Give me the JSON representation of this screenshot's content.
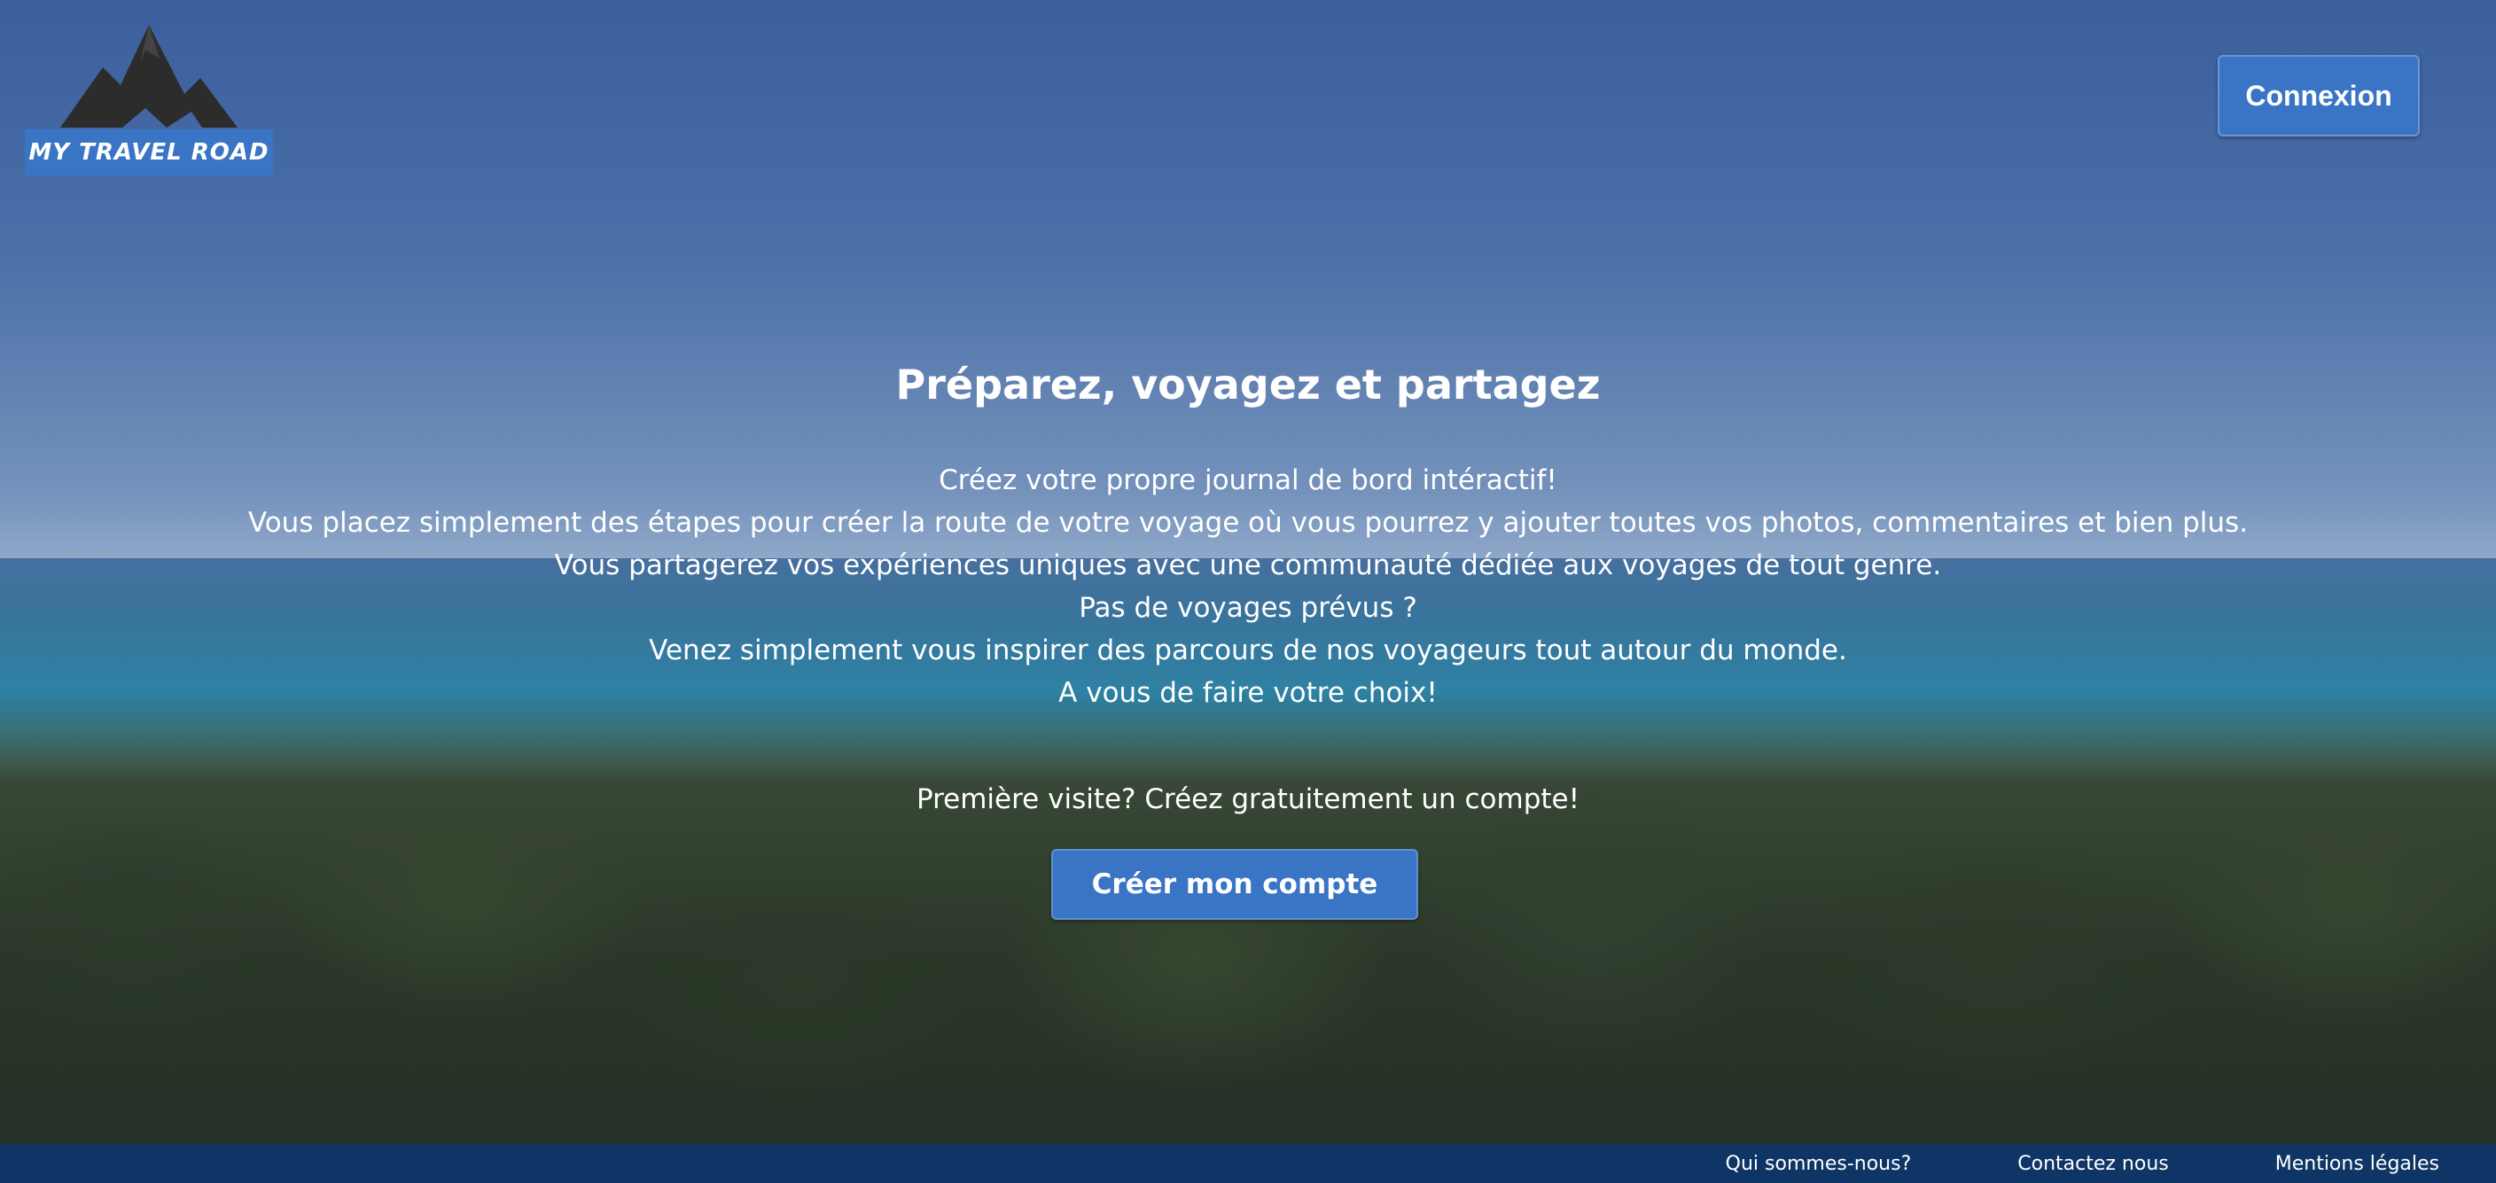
{
  "logo": {
    "text": "MY TRAVEL ROAD",
    "icon": "mountain-icon"
  },
  "header": {
    "login_label": "Connexion"
  },
  "hero": {
    "title": "Préparez, voyagez et partagez",
    "lines": [
      "Créez votre propre journal de bord intéractif!",
      "Vous placez simplement des étapes pour créer la route de votre voyage où vous pourrez y ajouter toutes vos photos, commentaires et bien plus.",
      "Vous partagerez vos expériences uniques avec une communauté dédiée aux voyages de tout genre.",
      "Pas de voyages prévus ?",
      "Venez simplement vous inspirer des parcours de nos voyageurs tout autour du monde.",
      "A vous de faire votre choix!"
    ],
    "cta_text": "Première visite? Créez gratuitement un compte!",
    "cta_button": "Créer mon compte"
  },
  "footer": {
    "links": [
      "Qui sommes-nous?",
      "Contactez nous",
      "Mentions légales"
    ]
  },
  "colors": {
    "accent": "#3a74c4",
    "footer_bg": "#0f3566",
    "text": "#ffffff"
  }
}
